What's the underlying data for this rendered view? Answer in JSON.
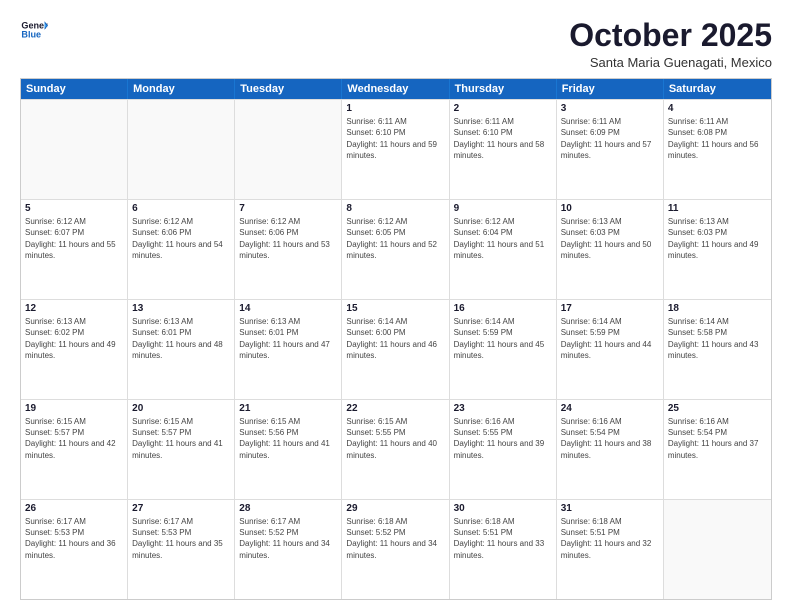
{
  "logo": {
    "line1": "General",
    "line2": "Blue"
  },
  "title": "October 2025",
  "location": "Santa Maria Guenagati, Mexico",
  "days": [
    "Sunday",
    "Monday",
    "Tuesday",
    "Wednesday",
    "Thursday",
    "Friday",
    "Saturday"
  ],
  "rows": [
    [
      {
        "date": "",
        "info": ""
      },
      {
        "date": "",
        "info": ""
      },
      {
        "date": "",
        "info": ""
      },
      {
        "date": "1",
        "info": "Sunrise: 6:11 AM\nSunset: 6:10 PM\nDaylight: 11 hours and 59 minutes."
      },
      {
        "date": "2",
        "info": "Sunrise: 6:11 AM\nSunset: 6:10 PM\nDaylight: 11 hours and 58 minutes."
      },
      {
        "date": "3",
        "info": "Sunrise: 6:11 AM\nSunset: 6:09 PM\nDaylight: 11 hours and 57 minutes."
      },
      {
        "date": "4",
        "info": "Sunrise: 6:11 AM\nSunset: 6:08 PM\nDaylight: 11 hours and 56 minutes."
      }
    ],
    [
      {
        "date": "5",
        "info": "Sunrise: 6:12 AM\nSunset: 6:07 PM\nDaylight: 11 hours and 55 minutes."
      },
      {
        "date": "6",
        "info": "Sunrise: 6:12 AM\nSunset: 6:06 PM\nDaylight: 11 hours and 54 minutes."
      },
      {
        "date": "7",
        "info": "Sunrise: 6:12 AM\nSunset: 6:06 PM\nDaylight: 11 hours and 53 minutes."
      },
      {
        "date": "8",
        "info": "Sunrise: 6:12 AM\nSunset: 6:05 PM\nDaylight: 11 hours and 52 minutes."
      },
      {
        "date": "9",
        "info": "Sunrise: 6:12 AM\nSunset: 6:04 PM\nDaylight: 11 hours and 51 minutes."
      },
      {
        "date": "10",
        "info": "Sunrise: 6:13 AM\nSunset: 6:03 PM\nDaylight: 11 hours and 50 minutes."
      },
      {
        "date": "11",
        "info": "Sunrise: 6:13 AM\nSunset: 6:03 PM\nDaylight: 11 hours and 49 minutes."
      }
    ],
    [
      {
        "date": "12",
        "info": "Sunrise: 6:13 AM\nSunset: 6:02 PM\nDaylight: 11 hours and 49 minutes."
      },
      {
        "date": "13",
        "info": "Sunrise: 6:13 AM\nSunset: 6:01 PM\nDaylight: 11 hours and 48 minutes."
      },
      {
        "date": "14",
        "info": "Sunrise: 6:13 AM\nSunset: 6:01 PM\nDaylight: 11 hours and 47 minutes."
      },
      {
        "date": "15",
        "info": "Sunrise: 6:14 AM\nSunset: 6:00 PM\nDaylight: 11 hours and 46 minutes."
      },
      {
        "date": "16",
        "info": "Sunrise: 6:14 AM\nSunset: 5:59 PM\nDaylight: 11 hours and 45 minutes."
      },
      {
        "date": "17",
        "info": "Sunrise: 6:14 AM\nSunset: 5:59 PM\nDaylight: 11 hours and 44 minutes."
      },
      {
        "date": "18",
        "info": "Sunrise: 6:14 AM\nSunset: 5:58 PM\nDaylight: 11 hours and 43 minutes."
      }
    ],
    [
      {
        "date": "19",
        "info": "Sunrise: 6:15 AM\nSunset: 5:57 PM\nDaylight: 11 hours and 42 minutes."
      },
      {
        "date": "20",
        "info": "Sunrise: 6:15 AM\nSunset: 5:57 PM\nDaylight: 11 hours and 41 minutes."
      },
      {
        "date": "21",
        "info": "Sunrise: 6:15 AM\nSunset: 5:56 PM\nDaylight: 11 hours and 41 minutes."
      },
      {
        "date": "22",
        "info": "Sunrise: 6:15 AM\nSunset: 5:55 PM\nDaylight: 11 hours and 40 minutes."
      },
      {
        "date": "23",
        "info": "Sunrise: 6:16 AM\nSunset: 5:55 PM\nDaylight: 11 hours and 39 minutes."
      },
      {
        "date": "24",
        "info": "Sunrise: 6:16 AM\nSunset: 5:54 PM\nDaylight: 11 hours and 38 minutes."
      },
      {
        "date": "25",
        "info": "Sunrise: 6:16 AM\nSunset: 5:54 PM\nDaylight: 11 hours and 37 minutes."
      }
    ],
    [
      {
        "date": "26",
        "info": "Sunrise: 6:17 AM\nSunset: 5:53 PM\nDaylight: 11 hours and 36 minutes."
      },
      {
        "date": "27",
        "info": "Sunrise: 6:17 AM\nSunset: 5:53 PM\nDaylight: 11 hours and 35 minutes."
      },
      {
        "date": "28",
        "info": "Sunrise: 6:17 AM\nSunset: 5:52 PM\nDaylight: 11 hours and 34 minutes."
      },
      {
        "date": "29",
        "info": "Sunrise: 6:18 AM\nSunset: 5:52 PM\nDaylight: 11 hours and 34 minutes."
      },
      {
        "date": "30",
        "info": "Sunrise: 6:18 AM\nSunset: 5:51 PM\nDaylight: 11 hours and 33 minutes."
      },
      {
        "date": "31",
        "info": "Sunrise: 6:18 AM\nSunset: 5:51 PM\nDaylight: 11 hours and 32 minutes."
      },
      {
        "date": "",
        "info": ""
      }
    ]
  ]
}
